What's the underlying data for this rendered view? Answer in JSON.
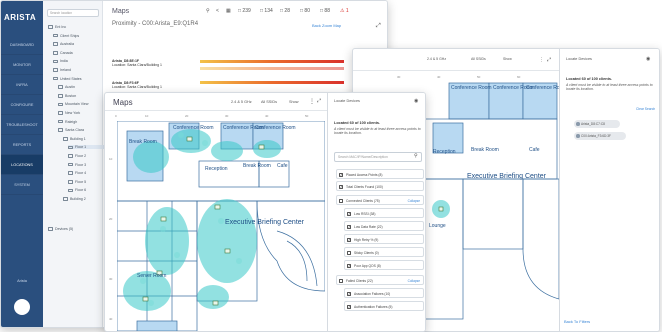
{
  "window1": {
    "logo": "ARISTA",
    "nav": [
      "DASHBOARD",
      "MONITOR",
      "INFRA",
      "CONFIGURE",
      "TROUBLESHOOT",
      "REPORTS",
      "LOCATIONS",
      "SYSTEM"
    ],
    "nav_active": "LOCATIONS",
    "nav_bottom": "Arista",
    "tree_search_placeholder": "Search location",
    "tree": [
      {
        "label": "Ent Inc",
        "level": 0
      },
      {
        "label": "Client Ships",
        "level": 1
      },
      {
        "label": "Australia",
        "level": 1
      },
      {
        "label": "Canada",
        "level": 1
      },
      {
        "label": "India",
        "level": 1
      },
      {
        "label": "Ireland",
        "level": 1
      },
      {
        "label": "United States",
        "level": 1
      },
      {
        "label": "Austin",
        "level": 2
      },
      {
        "label": "Boston",
        "level": 2
      },
      {
        "label": "Mountain View",
        "level": 2
      },
      {
        "label": "New York",
        "level": 2
      },
      {
        "label": "Raleigh",
        "level": 2
      },
      {
        "label": "Santa Clara",
        "level": 2
      },
      {
        "label": "Building 1",
        "level": 3
      },
      {
        "label": "Floor 1",
        "level": 4,
        "selected": true
      },
      {
        "label": "Floor 2",
        "level": 4
      },
      {
        "label": "Floor 3",
        "level": 4
      },
      {
        "label": "Floor 4",
        "level": 4
      },
      {
        "label": "Floor 5",
        "level": 4
      },
      {
        "label": "Floor 6",
        "level": 4
      },
      {
        "label": "Building 2",
        "level": 3
      },
      {
        "label": "Devices (5)",
        "level": 0
      }
    ],
    "title": "Maps",
    "subtitle": "Proximity - C00:Arista_E9:Q1R4",
    "show_link": "Back Zoom Map",
    "toolbar_counts": [
      "239",
      "134",
      "28",
      "80",
      "88",
      "1"
    ],
    "proximity": [
      {
        "name": "Arista_D8:8E:1F",
        "location": "Location: Santa Clara/Building 1"
      },
      {
        "name": "Arista_D8:F3:6F",
        "location": "Location: Santa Clara/Building 1"
      }
    ]
  },
  "window2": {
    "controls": [
      "2.4 & 5 GHz",
      "All SSIDs",
      "Show"
    ],
    "ruler": [
      "30",
      "40",
      "50",
      "60"
    ],
    "panel_dropdown": "Locate Devices",
    "located": "Located 60 of 100 clients.",
    "located_note": "A client must be visible to at least three access points to locate its location.",
    "clear_search": "Clear Search",
    "chips": [
      "Arista_D8:C7:C8",
      "C00:Arista_F3:6D:3F"
    ],
    "back_link": "Back To Filters"
  },
  "window3": {
    "title": "Maps",
    "controls": [
      "2.4 & 5 GHz",
      "All SSIDs",
      "Show"
    ],
    "panel_dropdown": "Locate Devices",
    "located": "Located 60 of 100 clients.",
    "located_note": "A client must be visible to at least three access points to locate its location.",
    "search_placeholder": "Search MAC/IP/Name/Description",
    "filters": [
      {
        "label": "Placed Access Points (8)",
        "checked": true,
        "sub": false,
        "action": ""
      },
      {
        "label": "Total Clients Found (100)",
        "checked": true,
        "sub": false,
        "action": ""
      },
      {
        "label": "Connected Clients (75)",
        "checked": false,
        "sub": false,
        "action": "Collapse"
      },
      {
        "label": "Low RSSI (38)",
        "checked": true,
        "sub": true,
        "action": ""
      },
      {
        "label": "Low Data Rate (22)",
        "checked": true,
        "sub": true,
        "action": ""
      },
      {
        "label": "High Retry % (9)",
        "checked": true,
        "sub": true,
        "action": ""
      },
      {
        "label": "Sticky Clients (0)",
        "checked": false,
        "sub": true,
        "action": ""
      },
      {
        "label": "Poor App QOS (8)",
        "checked": true,
        "sub": true,
        "action": ""
      },
      {
        "label": "Failed Clients (22)",
        "checked": false,
        "sub": false,
        "action": "Collapse"
      },
      {
        "label": "Association Failures (10)",
        "checked": true,
        "sub": true,
        "action": ""
      },
      {
        "label": "Authentication Failures (5)",
        "checked": true,
        "sub": true,
        "action": ""
      }
    ],
    "ruler_top": [
      "0",
      "10",
      "20",
      "30",
      "40",
      "50"
    ],
    "ruler_left": [
      "10",
      "20",
      "30",
      "40"
    ]
  },
  "floorplan": {
    "rooms": [
      "Conference Room",
      "Conference Room",
      "Conference Room",
      "Break Room",
      "Reception",
      "Break Room",
      "Cafe",
      "Executive Briefing Center",
      "Server Room",
      "Lounge",
      "Reception",
      "Break Room",
      "Cafe",
      "Executive Briefing Center",
      "Conference Room",
      "Conference Room",
      "Conference Room"
    ]
  },
  "colors": {
    "nav_bg": "#2a4f7e",
    "accent": "#3a86d6",
    "heat": "#38c8c8",
    "wall": "#3c6fa0",
    "bar_hot": "#d9312c"
  }
}
